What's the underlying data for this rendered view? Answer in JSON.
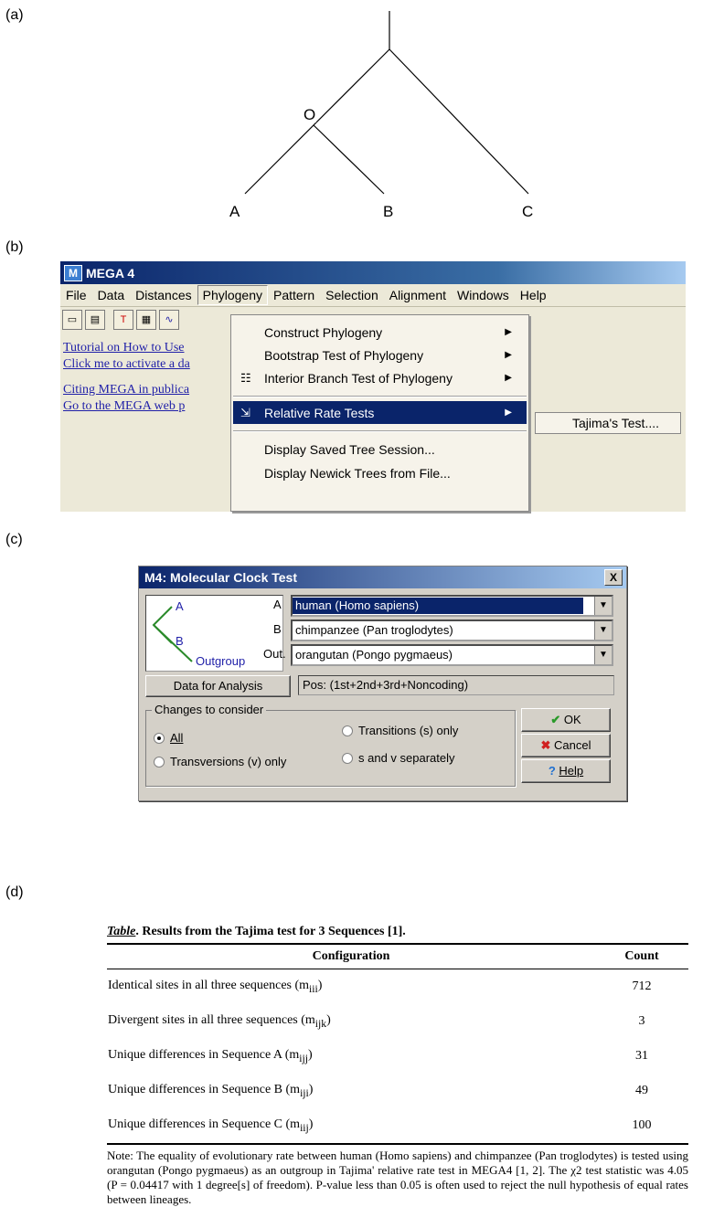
{
  "panels": {
    "a": "(a)",
    "b": "(b)",
    "c": "(c)",
    "d": "(d)"
  },
  "tree": {
    "internal_node": "O",
    "leaves": [
      "A",
      "B",
      "C"
    ]
  },
  "mega": {
    "title": "MEGA 4",
    "menu": [
      "File",
      "Data",
      "Distances",
      "Phylogeny",
      "Pattern",
      "Selection",
      "Alignment",
      "Windows",
      "Help"
    ],
    "active_menu": "Phylogeny",
    "toolbar_icons": [
      "new-file-icon",
      "open-data-icon",
      "text-editor-icon",
      "alignment-explorer-icon",
      "web-icon"
    ],
    "links": [
      "Tutorial on How to Use",
      "Click me to activate a da",
      "Citing MEGA in publica",
      "Go to the MEGA web p"
    ],
    "dropdown": [
      "Construct Phylogeny",
      "Bootstrap Test of Phylogeny",
      "Interior Branch Test of Phylogeny",
      "Relative Rate Tests",
      "Display Saved Tree Session...",
      "Display Newick Trees from File..."
    ],
    "submenu": "Tajima's Test...."
  },
  "dialog": {
    "title": "M4: Molecular Clock Test",
    "close": "X",
    "tree_labels": {
      "a": "A",
      "b": "B",
      "out": "Outgroup"
    },
    "rows": [
      {
        "label": "A",
        "value": "human (Homo sapiens)"
      },
      {
        "label": "B",
        "value": "chimpanzee (Pan troglodytes)"
      },
      {
        "label": "Out.",
        "value": "orangutan (Pongo pygmaeus)"
      }
    ],
    "data_button": "Data for Analysis",
    "data_info": "Pos: (1st+2nd+3rd+Noncoding)",
    "group_title": "Changes to consider",
    "options": {
      "all": "All",
      "transitions": "Transitions (s) only",
      "transversions": "Transversions (v) only",
      "separately": "s and v separately"
    },
    "selected_option": "All",
    "buttons": {
      "ok": "OK",
      "cancel": "Cancel",
      "help": "Help"
    }
  },
  "table": {
    "caption_prefix": "Table",
    "caption": ". Results from the Tajima test for 3 Sequences [1].",
    "headers": [
      "Configuration",
      "Count"
    ],
    "rows": [
      {
        "label": "Identical sites in all three sequences (m",
        "sub": "iii",
        "count": "712"
      },
      {
        "label": "Divergent sites in all three sequences (m",
        "sub": "ijk",
        "count": "3"
      },
      {
        "label": "Unique differences in Sequence A (m",
        "sub": "ijj",
        "count": "31"
      },
      {
        "label": "Unique differences in Sequence B (m",
        "sub": "iji",
        "count": "49"
      },
      {
        "label": "Unique differences in Sequence C (m",
        "sub": "iij",
        "count": "100"
      }
    ],
    "note": "Note: The equality of evolutionary rate between human (Homo sapiens) and chimpanzee (Pan troglodytes) is tested using orangutan (Pongo pygmaeus) as an outgroup in Tajima' relative rate test in MEGA4 [1, 2]. The χ2 test statistic was 4.05 (P = 0.04417 with 1 degree[s] of freedom). P-value less than 0.05 is often used to reject the null hypothesis of equal rates between lineages."
  }
}
